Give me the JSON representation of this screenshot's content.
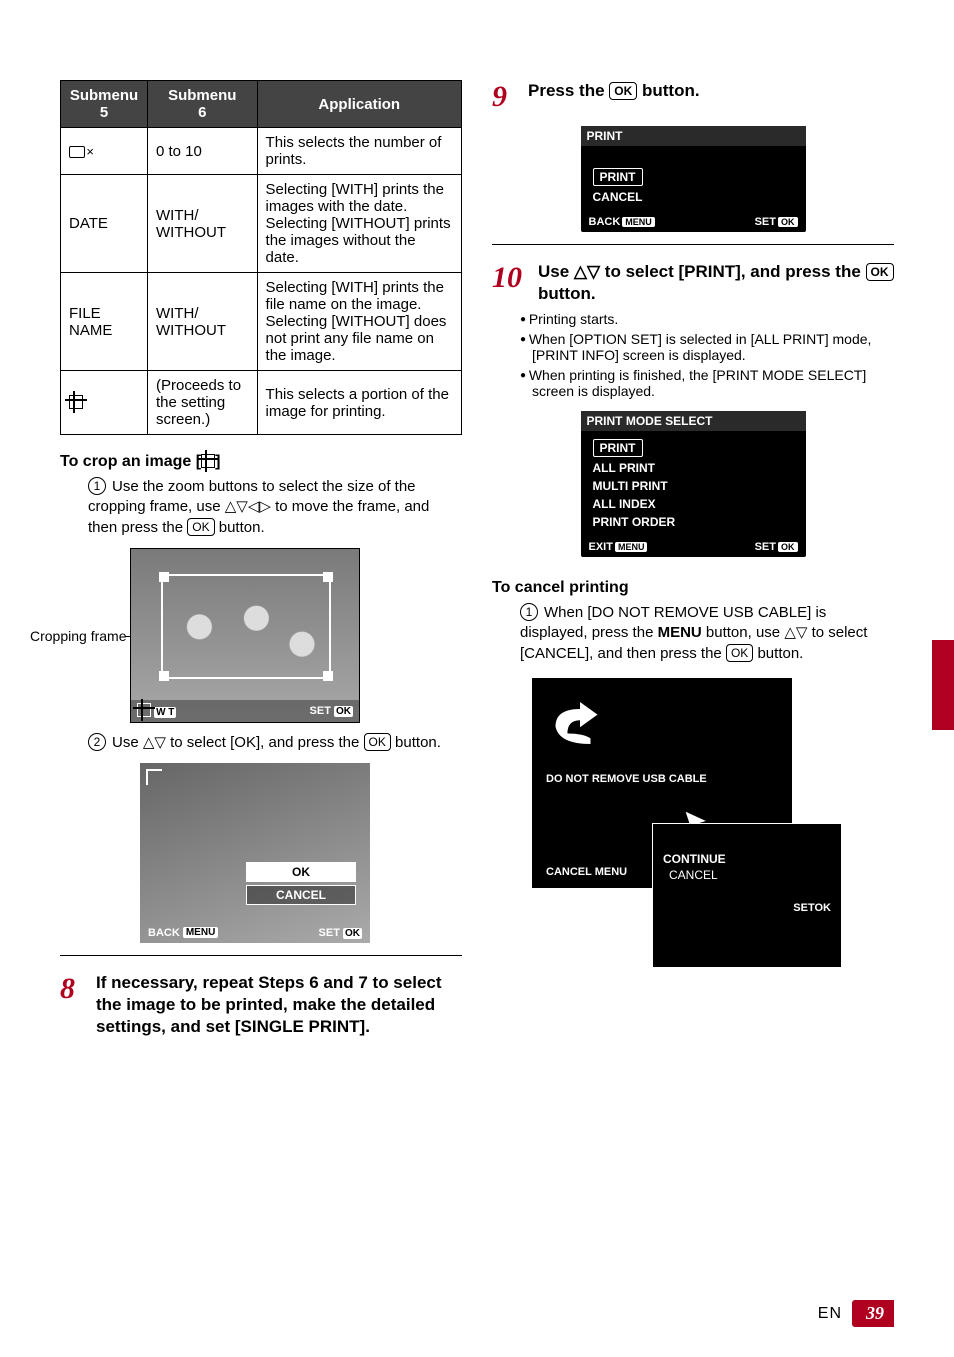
{
  "table": {
    "headers": {
      "c1a": "Submenu",
      "c1b": "5",
      "c2a": "Submenu",
      "c2b": "6",
      "c3": "Application"
    },
    "rows": [
      {
        "s5": "__PRINT_ICON__",
        "s6": "0 to 10",
        "app": "This selects the number of prints."
      },
      {
        "s5": "DATE",
        "s6": "WITH/\nWITHOUT",
        "app": "Selecting [WITH] prints the images with the date. Selecting [WITHOUT] prints the images without the date."
      },
      {
        "s5": "FILE NAME",
        "s6": "WITH/\nWITHOUT",
        "app": "Selecting [WITH] prints the file name on the image. Selecting [WITHOUT] does not print any file name on the image."
      },
      {
        "s5": "__CROP_ICON__",
        "s6": "(Proceeds to the setting screen.)",
        "app": "This selects a portion of the image for printing."
      }
    ]
  },
  "crop": {
    "heading_prefix": "To crop an image [",
    "heading_suffix": "]",
    "step1": "Use the zoom buttons to select the size of the cropping frame, use ",
    "step1b": " to move the frame, and then press the ",
    "step1c": " button.",
    "frame_label": "Cropping frame",
    "bar_left": "W T",
    "bar_right_set": "SET",
    "bar_right_ok": "OK",
    "step2a": "Use ",
    "step2b": " to select [OK], and press the ",
    "step2c": " button.",
    "ok_label": "OK",
    "cancel_label": "CANCEL",
    "back_label": "BACK",
    "menu_label": "MENU",
    "set_label": "SET"
  },
  "step8": {
    "num": "8",
    "text": "If necessary, repeat Steps 6 and 7 to select the image to be printed, make the detailed settings, and set [SINGLE PRINT]."
  },
  "step9": {
    "num": "9",
    "text_a": "Press the ",
    "text_b": " button.",
    "panel_title": "PRINT",
    "opt_print": "PRINT",
    "opt_cancel": "CANCEL",
    "back": "BACK",
    "menu": "MENU",
    "set": "SET",
    "ok": "OK"
  },
  "step10": {
    "num": "10",
    "text_a": "Use ",
    "text_b": " to select [PRINT], and press the ",
    "text_c": " button.",
    "b1": "Printing starts.",
    "b2": "When [OPTION SET] is selected in [ALL PRINT] mode, [PRINT INFO] screen is displayed.",
    "b3": "When printing is finished, the [PRINT MODE SELECT] screen is displayed.",
    "pms_title": "PRINT MODE SELECT",
    "pms_items": [
      "PRINT",
      "ALL PRINT",
      "MULTI PRINT",
      "ALL INDEX",
      "PRINT ORDER"
    ],
    "exit": "EXIT",
    "menu": "MENU",
    "set": "SET",
    "ok": "OK"
  },
  "cancel": {
    "heading": "To cancel printing",
    "step_a": "When [DO NOT REMOVE USB CABLE] is displayed, press the ",
    "menu_word": "MENU",
    "step_b": " button, use ",
    "step_c": " to select [CANCEL], and then press the ",
    "step_d": " button.",
    "msg": "DO NOT REMOVE USB CABLE",
    "cancel": "CANCEL",
    "menu": "MENU",
    "continue": "CONTINUE",
    "cancel2": "CANCEL",
    "set": "SET",
    "ok": "OK"
  },
  "footer": {
    "en": "EN",
    "page": "39"
  }
}
